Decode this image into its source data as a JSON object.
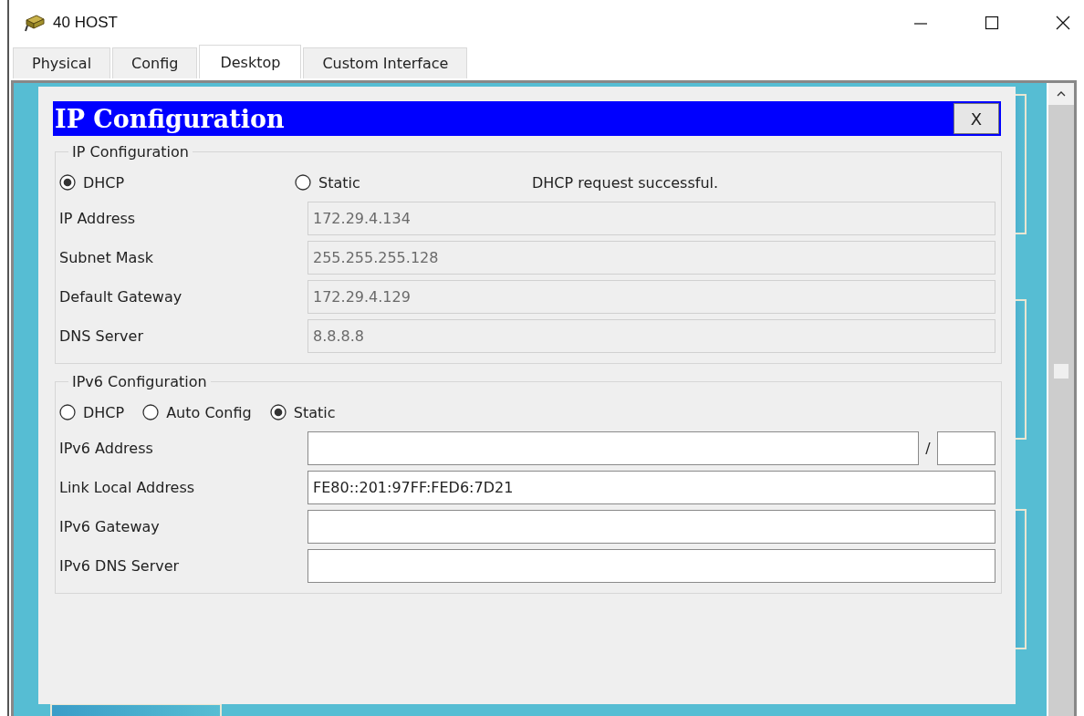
{
  "window": {
    "title": "40 HOST"
  },
  "tabs": [
    {
      "label": "Physical",
      "selected": false
    },
    {
      "label": "Config",
      "selected": false
    },
    {
      "label": "Desktop",
      "selected": true
    },
    {
      "label": "Custom Interface",
      "selected": false
    }
  ],
  "dialog": {
    "title": "IP Configuration",
    "close": "X",
    "ipv4": {
      "legend": "IP Configuration",
      "modes": [
        {
          "label": "DHCP",
          "selected": true
        },
        {
          "label": "Static",
          "selected": false
        }
      ],
      "status": "DHCP request successful.",
      "fields": [
        {
          "label": "IP Address",
          "value": "172.29.4.134",
          "disabled": true,
          "kind": "text"
        },
        {
          "label": "Subnet Mask",
          "value": "255.255.255.128",
          "disabled": true,
          "kind": "text"
        },
        {
          "label": "Default Gateway",
          "value": "172.29.4.129",
          "disabled": true,
          "kind": "text"
        },
        {
          "label": "DNS Server",
          "value": "8.8.8.8",
          "disabled": true,
          "kind": "text"
        }
      ]
    },
    "ipv6": {
      "legend": "IPv6 Configuration",
      "modes": [
        {
          "label": "DHCP",
          "selected": false
        },
        {
          "label": "Auto Config",
          "selected": false
        },
        {
          "label": "Static",
          "selected": true
        }
      ],
      "fields": [
        {
          "label": "IPv6 Address",
          "disabled": false,
          "kind": "prefix",
          "separator": "/"
        },
        {
          "label": "Link Local Address",
          "value": "FE80::201:97FF:FED6:7D21",
          "disabled": false,
          "kind": "text"
        },
        {
          "label": "IPv6 Gateway",
          "disabled": false,
          "kind": "text"
        },
        {
          "label": "IPv6 DNS Server",
          "disabled": false,
          "kind": "text"
        }
      ]
    }
  }
}
